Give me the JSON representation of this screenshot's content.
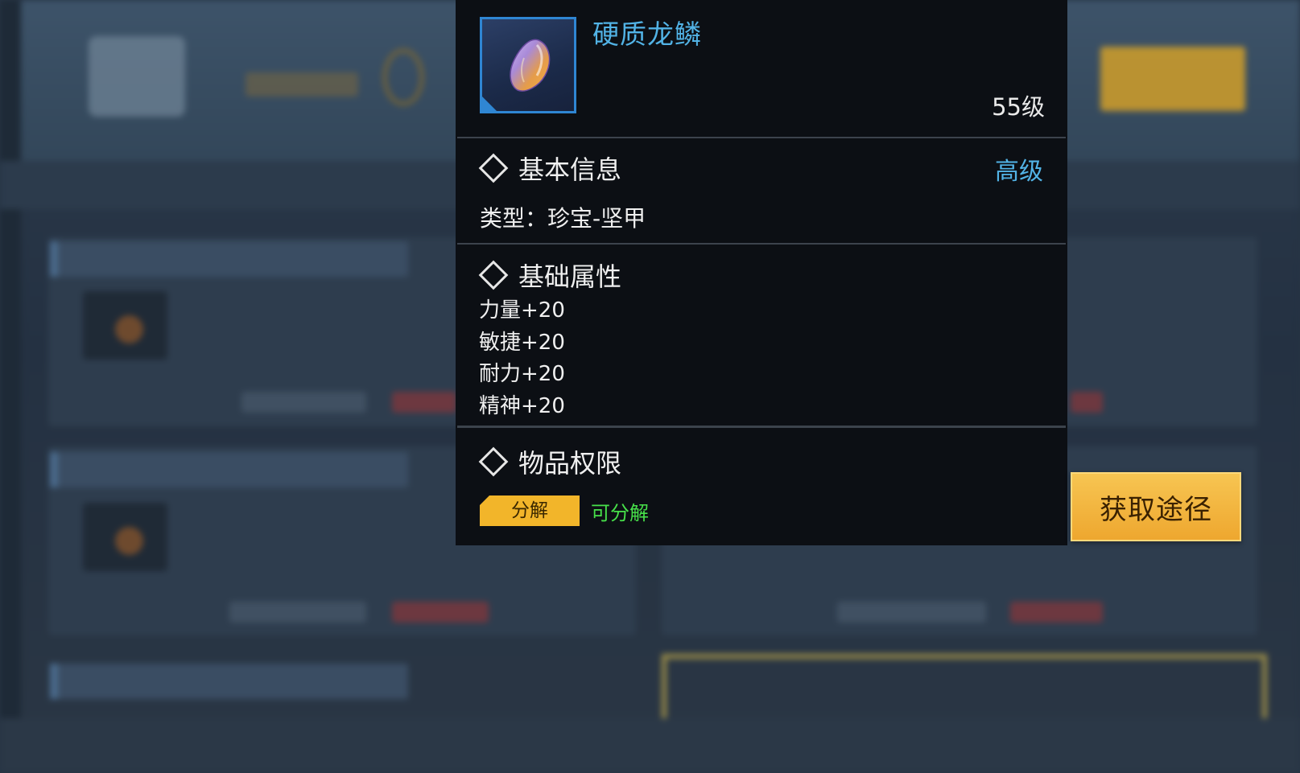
{
  "item": {
    "name": "硬质龙鳞",
    "level": "55级",
    "icon": "dragon-scale-gem-icon",
    "rarity_color": "#2f86d3"
  },
  "basic_info": {
    "title": "基本信息",
    "grade": "高级",
    "type_line": "类型：珍宝-坚甲"
  },
  "base_attributes": {
    "title": "基础属性",
    "items": [
      "力量+20",
      "敏捷+20",
      "耐力+20",
      "精神+20"
    ]
  },
  "permissions": {
    "title": "物品权限",
    "tag": "分解",
    "status": "可分解",
    "status_color": "#47e04a"
  },
  "obtain_button": {
    "label": "获取途径"
  },
  "colors": {
    "accent_blue": "#52b3e6",
    "gold": "#f2b52a",
    "panel_bg": "#0c0f14"
  }
}
